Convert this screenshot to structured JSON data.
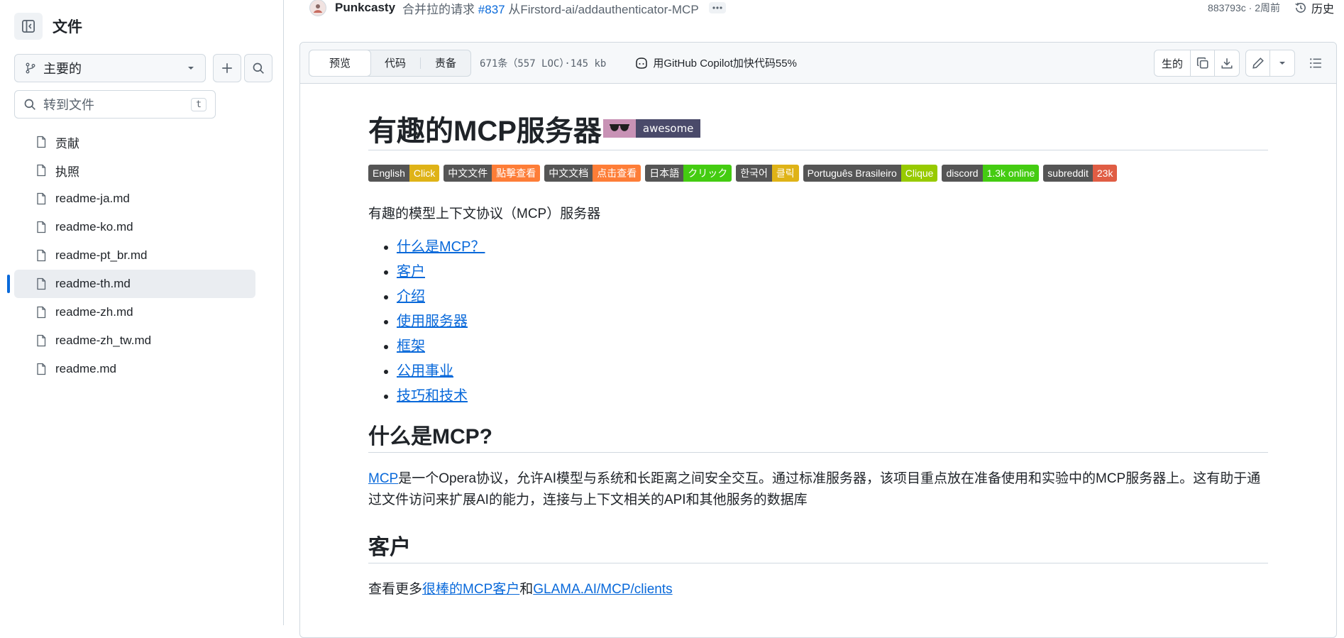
{
  "sidebar": {
    "title": "文件",
    "branch": "主要的",
    "goto_placeholder": "转到文件",
    "goto_shortcut": "t",
    "files": [
      {
        "label": "贡献",
        "active": false
      },
      {
        "label": "执照",
        "active": false
      },
      {
        "label": "readme-ja.md",
        "active": false
      },
      {
        "label": "readme-ko.md",
        "active": false
      },
      {
        "label": "readme-pt_br.md",
        "active": false
      },
      {
        "label": "readme-th.md",
        "active": true
      },
      {
        "label": "readme-zh.md",
        "active": false
      },
      {
        "label": "readme-zh_tw.md",
        "active": false
      },
      {
        "label": "readme.md",
        "active": false
      }
    ]
  },
  "commit": {
    "author": "Punkcasty",
    "message_prefix": "合并拉的请求",
    "pr": "#837",
    "message_suffix": "从Firstord-ai/addauthenticator-MCP",
    "sha_time": "883793c · 2周前",
    "history_label": "历史"
  },
  "file_header": {
    "tabs": [
      "预览",
      "代码",
      "责备"
    ],
    "active_tab": 0,
    "loc": "671条（557 LOC）·145 kb",
    "copilot": "用GitHub Copilot加快代码55%",
    "raw_label": "生的"
  },
  "readme": {
    "title": "有趣的MCP服务器",
    "awesome_label": "awesome",
    "badges": [
      {
        "left": "English",
        "right": "Click",
        "color": "#dfb317"
      },
      {
        "left": "中文文件",
        "right": "點擊查看",
        "color": "#fe7d37"
      },
      {
        "left": "中文文档",
        "right": "点击查看",
        "color": "#fe7d37"
      },
      {
        "left": "日本語",
        "right": "クリック",
        "color": "#4c1"
      },
      {
        "left": "한국어",
        "right": "클릭",
        "color": "#dfb317"
      },
      {
        "left": "Português Brasileiro",
        "right": "Clique",
        "color": "#97ca00"
      },
      {
        "left": "discord",
        "right": "1.3k online",
        "color": "#4c1"
      },
      {
        "left": "subreddit",
        "right": "23k",
        "color": "#e05d44"
      }
    ],
    "intro": "有趣的模型上下文协议（MCP）服务器",
    "toc": [
      "什么是MCP？",
      "客户",
      "介绍",
      "使用服务器",
      "框架",
      "公用事业",
      "技巧和技术"
    ],
    "section1_title": "什么是MCP?",
    "section1_link": "MCP",
    "section1_text": "是一个Opera协议，允许AI模型与系统和长距离之间安全交互。通过标准服务器，该项目重点放在准备使用和实验中的MCP服务器上。这有助于通过文件访问来扩展AI的能力，连接与上下文相关的API和其他服务的数据库",
    "section2_title": "客户",
    "section2_prefix": "查看更多",
    "section2_link1": "很棒的MCP客户",
    "section2_mid": "和",
    "section2_link2": "GLAMA.AI/MCP/clients"
  }
}
